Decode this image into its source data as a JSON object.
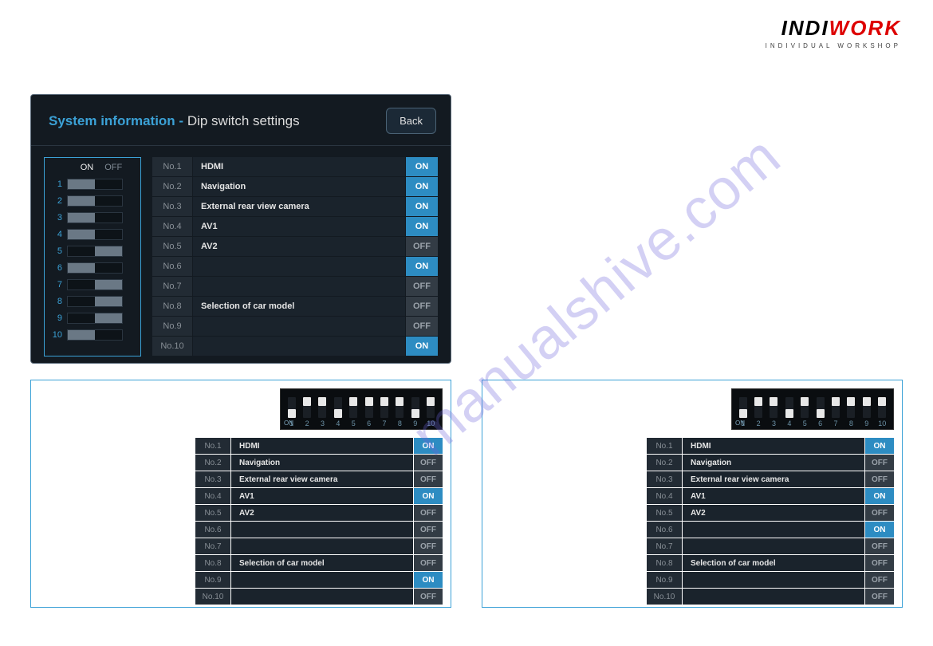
{
  "logo": {
    "main_a": "INDI",
    "main_b": "WORK",
    "sub": "INDIVIDUAL WORKSHOP"
  },
  "watermark": "manualshive.com",
  "main_panel": {
    "title_a": "System information - ",
    "title_b": "Dip switch settings",
    "back": "Back",
    "dip_header": {
      "on": "ON",
      "off": "OFF"
    },
    "dip_positions": [
      "on",
      "on",
      "on",
      "on",
      "off",
      "on",
      "off",
      "off",
      "off",
      "on"
    ],
    "rows": [
      {
        "no": "No.1",
        "label": "HDMI",
        "state": "ON"
      },
      {
        "no": "No.2",
        "label": "Navigation",
        "state": "ON"
      },
      {
        "no": "No.3",
        "label": "External rear view camera",
        "state": "ON"
      },
      {
        "no": "No.4",
        "label": "AV1",
        "state": "ON"
      },
      {
        "no": "No.5",
        "label": "AV2",
        "state": "OFF"
      },
      {
        "no": "No.6",
        "label": "",
        "state": "ON"
      },
      {
        "no": "No.7",
        "label": "",
        "state": "OFF"
      },
      {
        "no": "No.8",
        "label": "Selection of car model",
        "state": "OFF"
      },
      {
        "no": "No.9",
        "label": "",
        "state": "OFF"
      },
      {
        "no": "No.10",
        "label": "",
        "state": "ON"
      }
    ]
  },
  "left_box": {
    "photo_positions": [
      "down",
      "up",
      "up",
      "down",
      "up",
      "up",
      "up",
      "up",
      "down",
      "up"
    ],
    "rows": [
      {
        "no": "No.1",
        "label": "HDMI",
        "state": "ON"
      },
      {
        "no": "No.2",
        "label": "Navigation",
        "state": "OFF"
      },
      {
        "no": "No.3",
        "label": "External rear view camera",
        "state": "OFF"
      },
      {
        "no": "No.4",
        "label": "AV1",
        "state": "ON"
      },
      {
        "no": "No.5",
        "label": "AV2",
        "state": "OFF"
      },
      {
        "no": "No.6",
        "label": "",
        "state": "OFF"
      },
      {
        "no": "No.7",
        "label": "",
        "state": "OFF"
      },
      {
        "no": "No.8",
        "label": "Selection of car model",
        "state": "OFF"
      },
      {
        "no": "No.9",
        "label": "",
        "state": "ON"
      },
      {
        "no": "No.10",
        "label": "",
        "state": "OFF"
      }
    ]
  },
  "right_box": {
    "photo_positions": [
      "down",
      "up",
      "up",
      "down",
      "up",
      "down",
      "up",
      "up",
      "up",
      "up"
    ],
    "rows": [
      {
        "no": "No.1",
        "label": "HDMI",
        "state": "ON"
      },
      {
        "no": "No.2",
        "label": "Navigation",
        "state": "OFF"
      },
      {
        "no": "No.3",
        "label": "External rear view camera",
        "state": "OFF"
      },
      {
        "no": "No.4",
        "label": "AV1",
        "state": "ON"
      },
      {
        "no": "No.5",
        "label": "AV2",
        "state": "OFF"
      },
      {
        "no": "No.6",
        "label": "",
        "state": "ON"
      },
      {
        "no": "No.7",
        "label": "",
        "state": "OFF"
      },
      {
        "no": "No.8",
        "label": "Selection of car model",
        "state": "OFF"
      },
      {
        "no": "No.9",
        "label": "",
        "state": "OFF"
      },
      {
        "no": "No.10",
        "label": "",
        "state": "OFF"
      }
    ]
  }
}
